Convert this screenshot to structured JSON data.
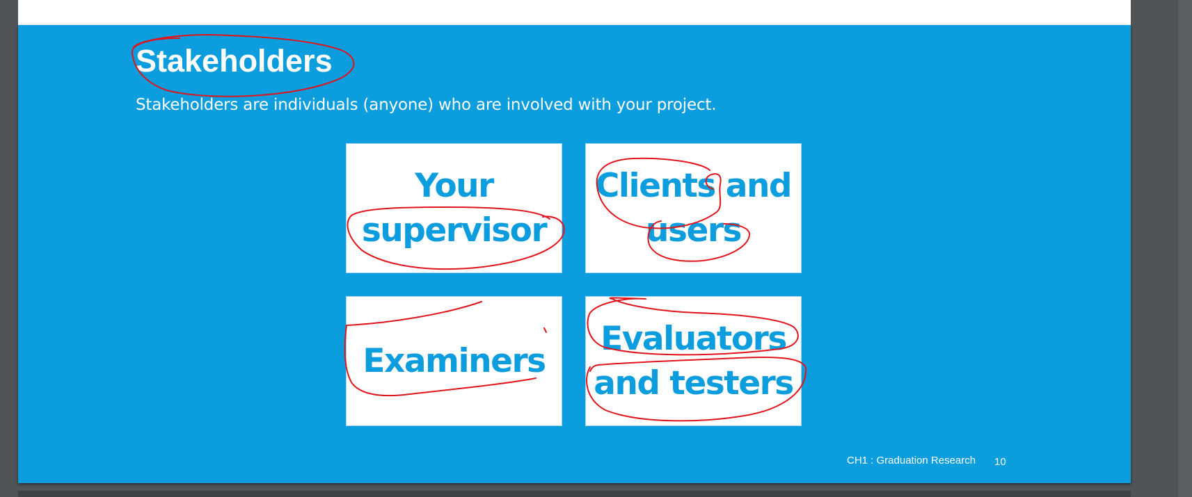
{
  "slide": {
    "title": "Stakeholders",
    "subtitle": "Stakeholders are individuals (anyone) who are involved with your project.",
    "cards": [
      {
        "label": "Your supervisor"
      },
      {
        "label": "Clients and users"
      },
      {
        "label": "Examiners"
      },
      {
        "label": "Evaluators and testers"
      }
    ],
    "footer": "CH1 : Graduation Research",
    "page_number": "10"
  },
  "colors": {
    "slide_background": "#0b9ddd",
    "card_text": "#0b9ddd",
    "ink": "#e0141b",
    "viewer_background": "#515456"
  }
}
